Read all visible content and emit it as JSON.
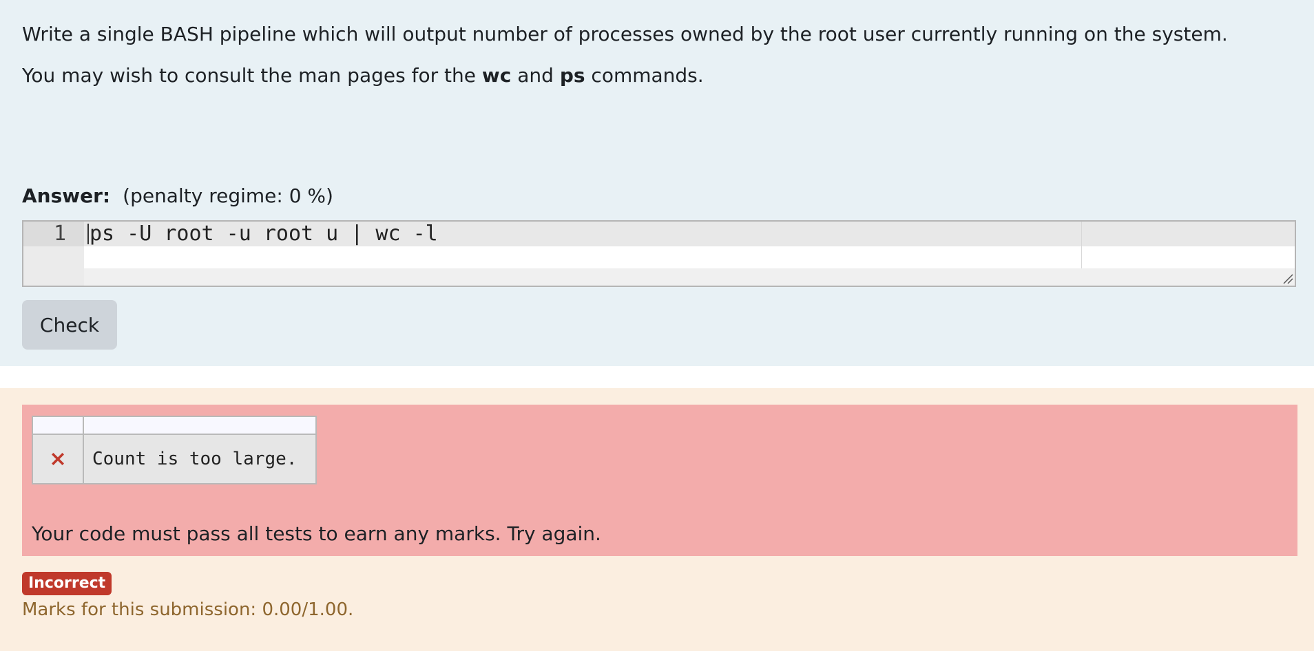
{
  "question": {
    "text_1": "Write a single BASH pipeline which will output number of processes owned by the root user currently running on the system.",
    "text_2_before": "You may wish to consult the man pages for the ",
    "text_2_cmd1": "wc",
    "text_2_and": " and ",
    "text_2_cmd2": "ps",
    "text_2_after": " commands."
  },
  "answer": {
    "label": "Answer:",
    "penalty": "(penalty regime: 0 %)",
    "line_number": "1",
    "code": "ps -U root -u root u | wc -l"
  },
  "check_button": {
    "label": "Check"
  },
  "feedback": {
    "result_icon": "close-icon",
    "result_message": "Count is too large.",
    "message": "Your code must pass all tests to earn any marks. Try again.",
    "status_badge": "Incorrect",
    "marks": "Marks for this submission: 0.00/1.00."
  },
  "colors": {
    "question_bg": "#e8f1f5",
    "outcome_bg": "#fbeee0",
    "feedback_bg": "#f3acab",
    "incorrect_red": "#c0392b",
    "marks_text": "#8e662e"
  }
}
